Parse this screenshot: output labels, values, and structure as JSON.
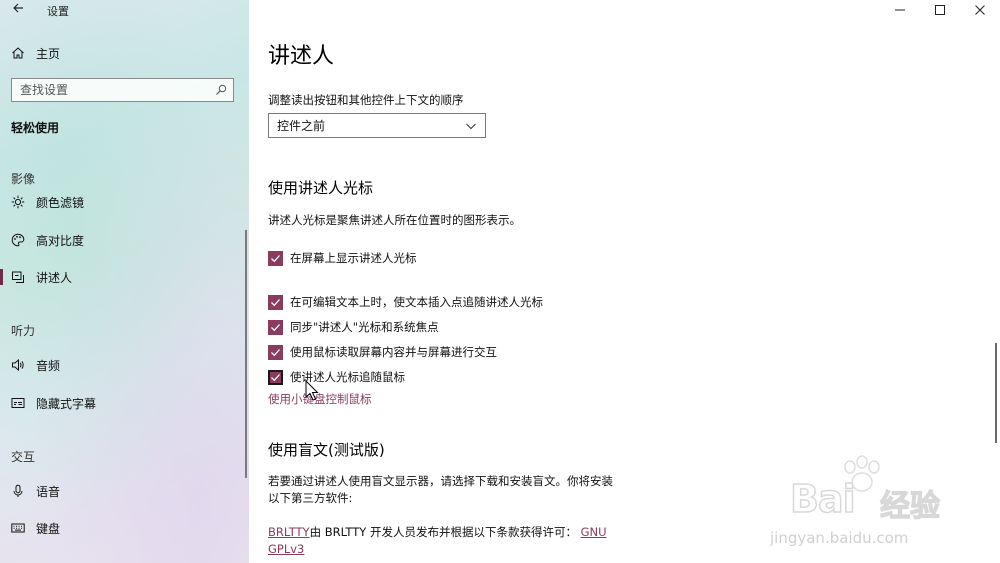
{
  "window": {
    "app_title": "设置"
  },
  "sidebar": {
    "home_label": "主页",
    "search_placeholder": "查找设置",
    "category_title": "轻松使用",
    "sections": [
      {
        "title": "影像"
      },
      {
        "title": "听力"
      },
      {
        "title": "交互"
      }
    ],
    "items": [
      {
        "label": "颜色滤镜",
        "icon": "sun-icon"
      },
      {
        "label": "高对比度",
        "icon": "palette-icon"
      },
      {
        "label": "讲述人",
        "icon": "narrator-icon",
        "selected": true
      },
      {
        "label": "音频",
        "icon": "speaker-icon"
      },
      {
        "label": "隐藏式字幕",
        "icon": "caption-icon"
      },
      {
        "label": "语音",
        "icon": "microphone-icon"
      },
      {
        "label": "键盘",
        "icon": "keyboard-icon"
      }
    ]
  },
  "main": {
    "page_title": "讲述人",
    "reading_order_label": "调整读出按钮和其他控件上下文的顺序",
    "reading_order_value": "控件之前",
    "cursor_section": {
      "heading": "使用讲述人光标",
      "description": "讲述人光标是聚焦讲述人所在位置时的图形表示。",
      "checkboxes": [
        {
          "label": "在屏幕上显示讲述人光标",
          "checked": true
        },
        {
          "label": "在可编辑文本上时，使文本插入点追随讲述人光标",
          "checked": true
        },
        {
          "label": "同步\"讲述人\"光标和系统焦点",
          "checked": true
        },
        {
          "label": "使用鼠标读取屏幕内容并与屏幕进行交互",
          "checked": true
        },
        {
          "label": "使讲述人光标追随鼠标",
          "checked": true
        }
      ],
      "link": "使用小键盘控制鼠标"
    },
    "braille_section": {
      "heading": "使用盲文(测试版)",
      "description": "若要通过讲述人使用盲文显示器，请选择下载和安装盲文。你将安装以下第三方软件:",
      "license_link1": "BRLTTY",
      "license_text": "由 BRLTTY 开发人员发布并根据以下条款获得许可：",
      "license_link2": "GNU GPLv3"
    }
  },
  "watermark": {
    "text": "Bai",
    "text2": "经验",
    "url": "jingyan.baidu.com"
  },
  "colors": {
    "accent": "#8a3b5e",
    "selected_bar": "#6e2b49"
  }
}
